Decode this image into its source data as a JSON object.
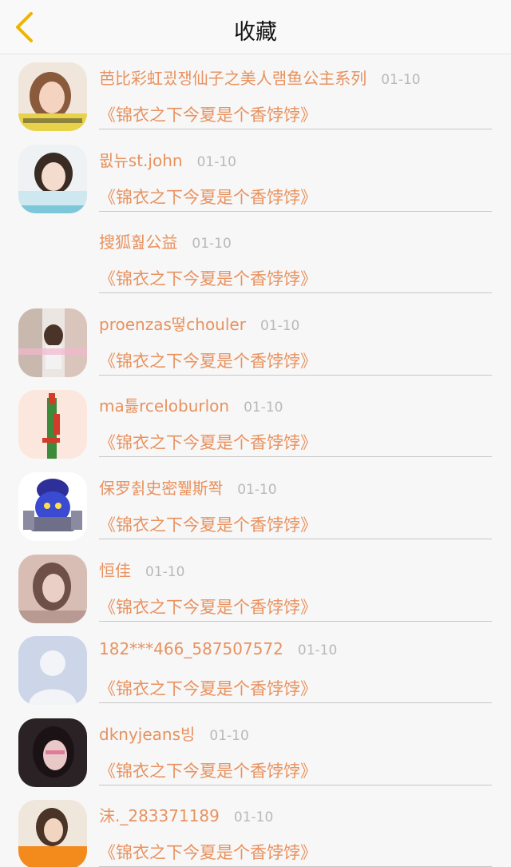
{
  "header": {
    "title": "收藏",
    "back_icon": "chevron-left-icon",
    "accent_color": "#f0b400"
  },
  "text_color": "#e8925f",
  "time_color": "#b9b9b9",
  "items": [
    {
      "name": "芭比彩虹굈쟁仙子之美人램鱼公主系列",
      "time": "01-10",
      "title": "《锦衣之下今夏是个香饽饽》",
      "avatar": "photo"
    },
    {
      "name": "뮚뉴st.john",
      "time": "01-10",
      "title": "《锦衣之下今夏是个香饽饽》",
      "avatar": "photo"
    },
    {
      "name": "搜狐훮公益",
      "time": "01-10",
      "title": "《锦衣之下今夏是个香饽饽》",
      "avatar": "none"
    },
    {
      "name": "proenzas뗳chouler",
      "time": "01-10",
      "title": "《锦衣之下今夏是个香饽饽》",
      "avatar": "photo"
    },
    {
      "name": "ma틇rceloburlon",
      "time": "01-10",
      "title": "《锦衣之下今夏是个香饽饽》",
      "avatar": "photo"
    },
    {
      "name": "保罗췱史密쮍斯쫙",
      "time": "01-10",
      "title": "《锦衣之下今夏是个香饽饽》",
      "avatar": "photo"
    },
    {
      "name": "恒佳",
      "time": "01-10",
      "title": "《锦衣之下今夏是个香饽饽》",
      "avatar": "photo"
    },
    {
      "name": "182***466_587507572",
      "time": "01-10",
      "title": "《锦衣之下今夏是个香饽饽》",
      "avatar": "default"
    },
    {
      "name": "dknyjeans빙",
      "time": "01-10",
      "title": "《锦衣之下今夏是个香饽饽》",
      "avatar": "photo"
    },
    {
      "name": "沫._283371189",
      "time": "01-10",
      "title": "《锦衣之下今夏是个香饽饽》",
      "avatar": "photo"
    }
  ]
}
